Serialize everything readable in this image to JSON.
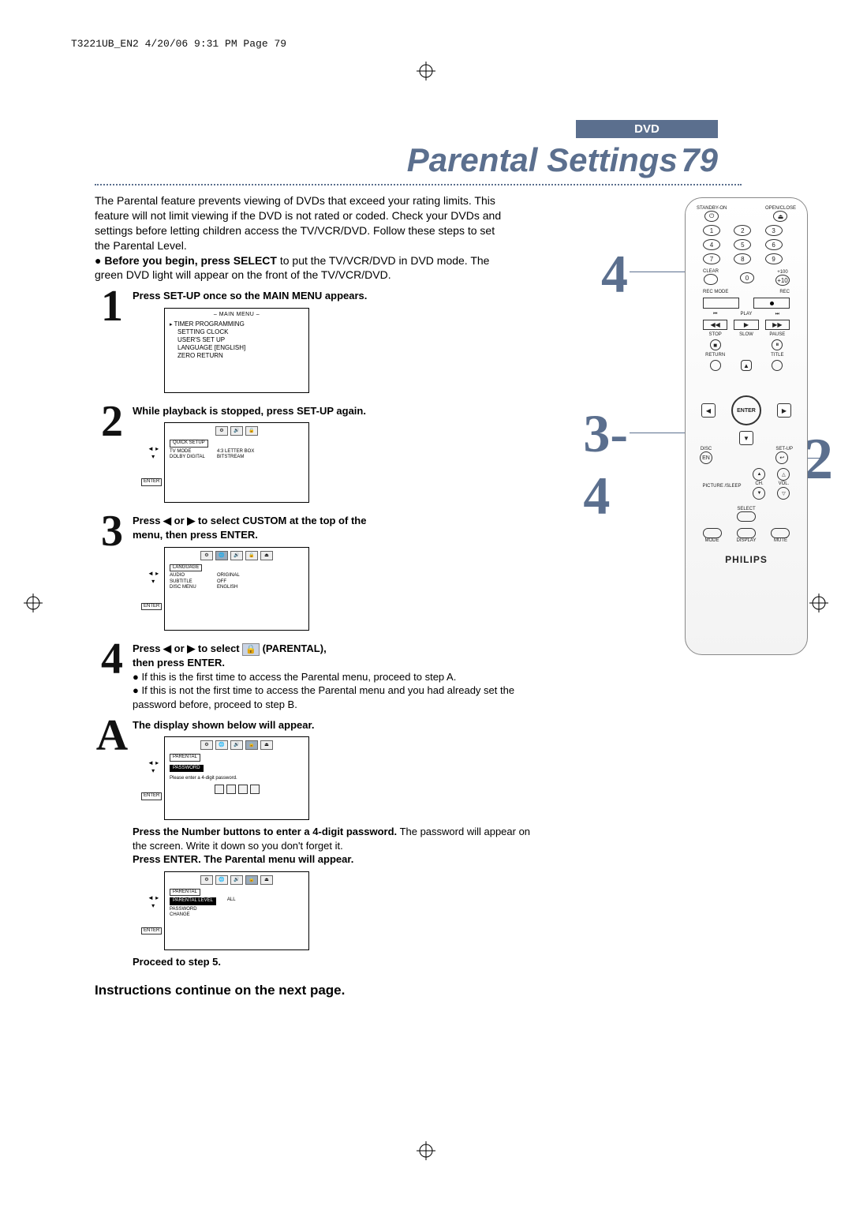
{
  "print_info": "T3221UB_EN2  4/20/06  9:31 PM  Page 79",
  "header": {
    "dvd_label": "DVD",
    "title": "Parental Settings",
    "page_no": "79"
  },
  "intro": {
    "p1": "The Parental feature prevents viewing of DVDs that exceed your rating limits. This feature will not limit viewing if the DVD is not rated or coded.  Check your DVDs and settings before letting children access the TV/VCR/DVD. Follow these steps to set the Parental Level.",
    "bullet_pre": "Before you begin, press SELECT",
    "bullet_post": " to put the TV/VCR/DVD in DVD mode.  The green DVD light will appear on the front of the TV/VCR/DVD."
  },
  "steps": {
    "s1": {
      "n": "1",
      "text": "Press SET-UP once so the MAIN MENU appears."
    },
    "s2": {
      "n": "2",
      "text": "While playback is stopped, press SET-UP again."
    },
    "s3": {
      "n": "3",
      "line1_a": "Press ",
      "line1_b": " or ",
      "line1_c": " to select CUSTOM at the top of the",
      "line2": "menu, then press ENTER."
    },
    "s4": {
      "n": "4",
      "line1_a": "Press ",
      "line1_b": " or ",
      "line1_c": " to select ",
      "line1_d": " (PARENTAL),",
      "line2": "then press ENTER.",
      "b1": "If this is the first time to access the Parental menu, proceed to step A.",
      "b2": "If this is not the first time to access the Parental menu and you had already set the password before, proceed to step B."
    },
    "sA": {
      "n": "A",
      "heading": "The display shown below will appear.",
      "after1_bold": "Press the Number buttons to enter a 4-digit password.",
      "after1_rest": "The password will appear on the screen. Write it down so you don't forget it.",
      "after2_bold": "Press ENTER. The Parental menu will appear.",
      "proceed": "Proceed to step 5."
    }
  },
  "osd1": {
    "title": "– MAIN MENU –",
    "items": [
      "TIMER PROGRAMMING",
      "SETTING CLOCK",
      "USER'S SET UP",
      "LANGUAGE  [ENGLISH]",
      "ZERO RETURN"
    ]
  },
  "osd2": {
    "tab": "QUICK SETUP",
    "rows": [
      [
        "TV MODE",
        "4:3 LETTER BOX"
      ],
      [
        "DOLBY DIGITAL",
        "BITSTREAM"
      ]
    ]
  },
  "osd3": {
    "tab": "LANGUAGE",
    "rows": [
      [
        "AUDIO",
        "ORIGINAL"
      ],
      [
        "SUBTITLE",
        "OFF"
      ],
      [
        "DISC MENU",
        "ENGLISH"
      ]
    ]
  },
  "osd4": {
    "tab": "PARENTAL",
    "tab2": "PASSWORD",
    "prompt": "Please enter a 4-digit password."
  },
  "osd5": {
    "tab": "PARENTAL",
    "rows": [
      [
        "PARENTAL LEVEL",
        "ALL"
      ],
      [
        "PASSWORD CHANGE",
        ""
      ]
    ]
  },
  "continue_text": "Instructions continue on the next page.",
  "callouts": {
    "c4": "4",
    "c34": "3-4",
    "c12": "1-2"
  },
  "remote": {
    "standby": "STANDBY-ON",
    "open": "OPEN/CLOSE",
    "nums": [
      "1",
      "2",
      "3",
      "4",
      "5",
      "6",
      "7",
      "8",
      "9",
      "0"
    ],
    "clear": "CLEAR",
    "plus100": "+100",
    "plus10": "+10",
    "recmode": "REC MODE",
    "rec": "REC",
    "play": "PLAY",
    "stop": "STOP",
    "slow": "SLOW",
    "pause": "PAUSE",
    "return": "RETURN",
    "title": "TITLE",
    "enter": "ENTER",
    "disc": "DISC",
    "setup": "SET-UP",
    "en": "EN",
    "picture": "PICTURE /SLEEP",
    "ch": "CH.",
    "vol": "VOL.",
    "select": "SELECT",
    "mode": "MODE",
    "display": "DISPLAY",
    "mute": "MUTE",
    "brand": "PHILIPS"
  }
}
